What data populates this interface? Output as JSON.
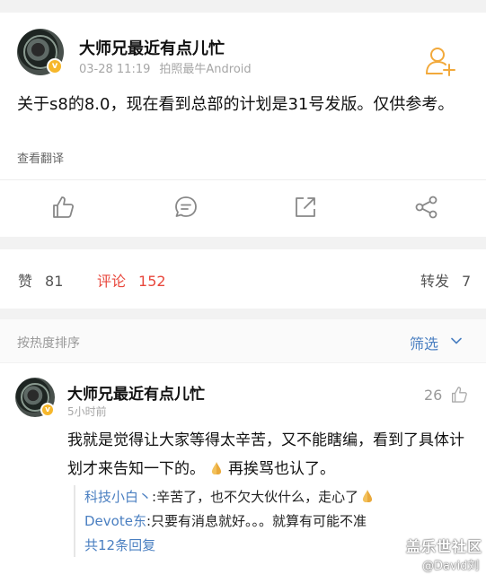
{
  "post": {
    "author": "大师兄最近有点儿忙",
    "date": "03-28 11:19",
    "source": "拍照最牛Android",
    "text": "关于s8的8.0，现在看到总部的计划是31号发版。仅供参考。",
    "translate": "查看翻译"
  },
  "stats": {
    "likes_label": "赞",
    "likes_count": "81",
    "comments_label": "评论",
    "comments_count": "152",
    "reposts_label": "转发",
    "reposts_count": "7"
  },
  "sort": {
    "label": "按热度排序",
    "filter_label": "筛选"
  },
  "comment": {
    "author": "大师兄最近有点儿忙",
    "time": "5小时前",
    "likes": "26",
    "text_part1": "我就是觉得让大家等得太辛苦，又不能瞎编，看到了具体计划才来告知一下的。",
    "text_part2": "再挨骂也认了。",
    "replies": [
      {
        "user": "科技小白丶",
        "text": ":辛苦了，也不欠大伙什么，走心了"
      },
      {
        "user": "Devote东",
        "text": ":只要有消息就好。。。就算有可能不准"
      }
    ],
    "more_replies": "共12条回复"
  },
  "watermark": {
    "line1": "盖乐世社区",
    "line2": "@David刘"
  },
  "colors": {
    "accent_red": "#e8473c",
    "link_blue": "#4a7fc1",
    "badge_yellow": "#f6b72b"
  },
  "icons": [
    "user-add-icon",
    "thumbs-up-icon",
    "comment-icon",
    "share-out-icon",
    "share-icon",
    "chevron-down-icon",
    "praying-hands-emoji"
  ]
}
